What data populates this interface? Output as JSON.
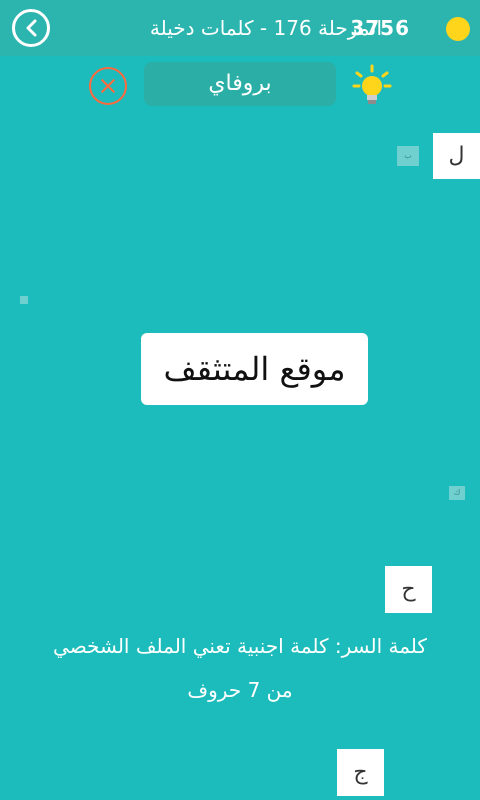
{
  "header": {
    "title": "المرحلة 176 - كلمات دخيلة",
    "coins": "3756"
  },
  "answer": {
    "text": "بروفاي"
  },
  "word_card": {
    "text": "موقع المتثقف"
  },
  "tiles": {
    "top_right": "ل",
    "small_top": "ب",
    "small_mid": "ك",
    "bottom_1": "ح",
    "bottom_2": "ج"
  },
  "question": {
    "line1": "كلمة السر: كلمة اجنبية تعني الملف الشخصي",
    "line2": "من 7 حروف"
  },
  "icons": {
    "back": "back-arrow-icon",
    "coin": "coin-icon",
    "hint": "lightbulb-icon",
    "clear": "close-icon"
  },
  "colors": {
    "background": "#1cbcbc",
    "header": "#2bb5ae",
    "coin": "#ffd51c",
    "clear": "#ff6a3d"
  }
}
